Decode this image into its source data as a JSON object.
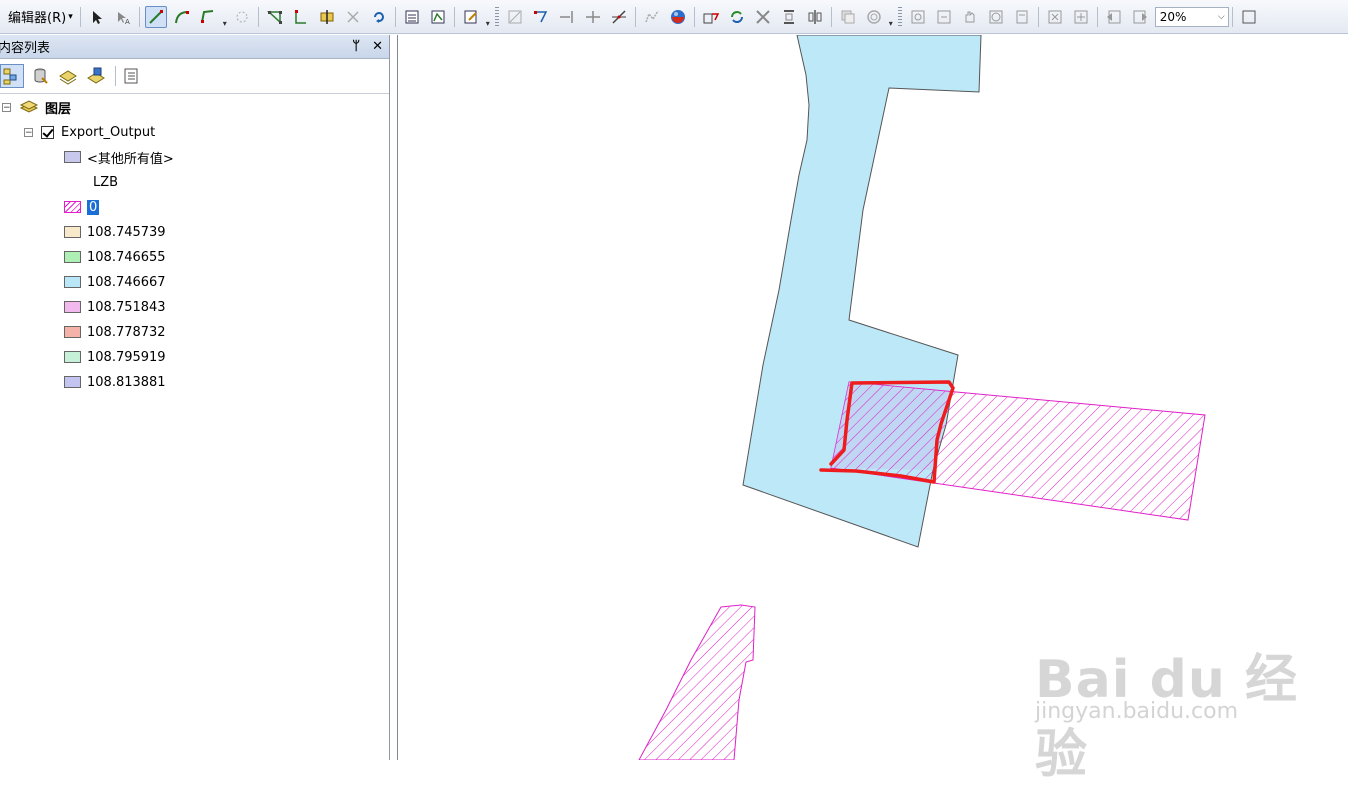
{
  "toolbar": {
    "editor_menu": "编辑器(R)",
    "zoom_value": "20%"
  },
  "toc": {
    "title": "内容列表",
    "pin_glyph": "ᛘ",
    "close_glyph": "✕",
    "root_label": "图层",
    "layer_name": "Export_Output",
    "field_label": "LZB",
    "classes": [
      {
        "label": "<其他所有值>",
        "color": "#c8c8ec"
      },
      {
        "label": "0",
        "color": "#e020c8",
        "hatched": true,
        "selected": true
      },
      {
        "label": "108.745739",
        "color": "#f7e9c9"
      },
      {
        "label": "108.746655",
        "color": "#aef0b4"
      },
      {
        "label": "108.746667",
        "color": "#b9e7f8"
      },
      {
        "label": "108.751843",
        "color": "#f1b9ee"
      },
      {
        "label": "108.778732",
        "color": "#f5b2a8"
      },
      {
        "label": "108.795919",
        "color": "#c6f0d8"
      },
      {
        "label": "108.813881",
        "color": "#c4c4f0"
      }
    ]
  },
  "map": {
    "fill_blue": "#bde8f8",
    "hatch_magenta": "#e020c8",
    "annotation_red": "#ee1c1c"
  },
  "watermark": {
    "logo": "Bai du 经验",
    "url": "jingyan.baidu.com"
  }
}
